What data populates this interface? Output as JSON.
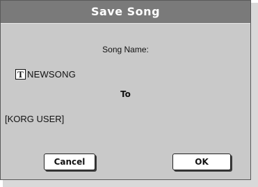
{
  "dialog": {
    "title": "Save Song",
    "song_name_label": "Song Name:",
    "song_name_value": "NEWSONG",
    "text_edit_icon_glyph": "T",
    "to_label": "To",
    "destination": "[KORG USER]",
    "cancel_label": "Cancel",
    "ok_label": "OK"
  },
  "icons": {
    "text_edit": "text-edit-icon"
  },
  "colors": {
    "titlebar": "#7a7a7a",
    "dialog_background": "#c9c9c9",
    "button_background": "#ffffff"
  }
}
